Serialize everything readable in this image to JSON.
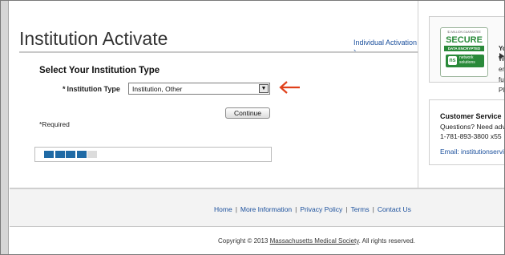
{
  "page": {
    "title": "Institution Activate",
    "individual_activation_link": "Individual Activation ›"
  },
  "form": {
    "section_heading": "Select Your Institution Type",
    "required_star": "*",
    "field_label": "Institution Type",
    "select_value": "Institution, Other",
    "continue_label": "Continue",
    "required_note": "*Required"
  },
  "progress": {
    "steps_total": 5,
    "steps_done": 4,
    "done_color": "#1f6aa5",
    "todo_color": "#dcdcdc"
  },
  "seal": {
    "top_text": "$1 MILLION GUARANTEE",
    "secure": "SECURE",
    "encrypted": "DATA ENCRYPTED",
    "ns": "ns",
    "network": "network",
    "solutions": "solutions",
    "side_lines": [
      "Yo",
      "W",
      "en",
      "fu",
      "Pl"
    ]
  },
  "customer_service": {
    "title": "Customer Service",
    "questions": "Questions? Need adv",
    "phone": "1-781-893-3800 x55",
    "email": "Email: institutionservi"
  },
  "footer": {
    "links": [
      "Home",
      "More Information",
      "Privacy Policy",
      "Terms",
      "Contact Us"
    ],
    "copyright_prefix": "Copyright © 2013 ",
    "copyright_org": "Massachusetts Medical Society",
    "copyright_suffix": ". All rights reserved."
  },
  "colors": {
    "link": "#1a4f9c",
    "arrow": "#e0401a",
    "seal_green": "#2a8a3a"
  }
}
